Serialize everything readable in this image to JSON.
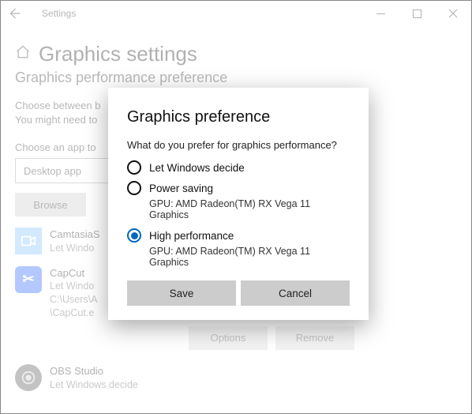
{
  "window": {
    "title": "Settings"
  },
  "page": {
    "heading": "Graphics settings",
    "subheading": "Graphics performance preference",
    "description1": "Choose between b",
    "description2": "You might need to",
    "label_choose_app": "Choose an app to",
    "combo_value": "Desktop app",
    "browse": "Browse"
  },
  "apps": [
    {
      "name": "CamtasiaS",
      "sub1": "Let Windo"
    },
    {
      "name": "CapCut",
      "sub1": "Let Windo",
      "sub2": "C:\\Users\\A",
      "sub3": "\\CapCut.e"
    },
    {
      "name": "OBS Studio",
      "sub1": "Let Windows decide"
    }
  ],
  "row_buttons": {
    "options": "Options",
    "remove": "Remove"
  },
  "dialog": {
    "title": "Graphics preference",
    "question": "What do you prefer for graphics performance?",
    "options": [
      {
        "label": "Let Windows decide"
      },
      {
        "label": "Power saving",
        "gpu": "GPU: AMD Radeon(TM) RX Vega 11 Graphics"
      },
      {
        "label": "High performance",
        "gpu": "GPU: AMD Radeon(TM) RX Vega 11 Graphics",
        "selected": true
      }
    ],
    "save": "Save",
    "cancel": "Cancel"
  }
}
